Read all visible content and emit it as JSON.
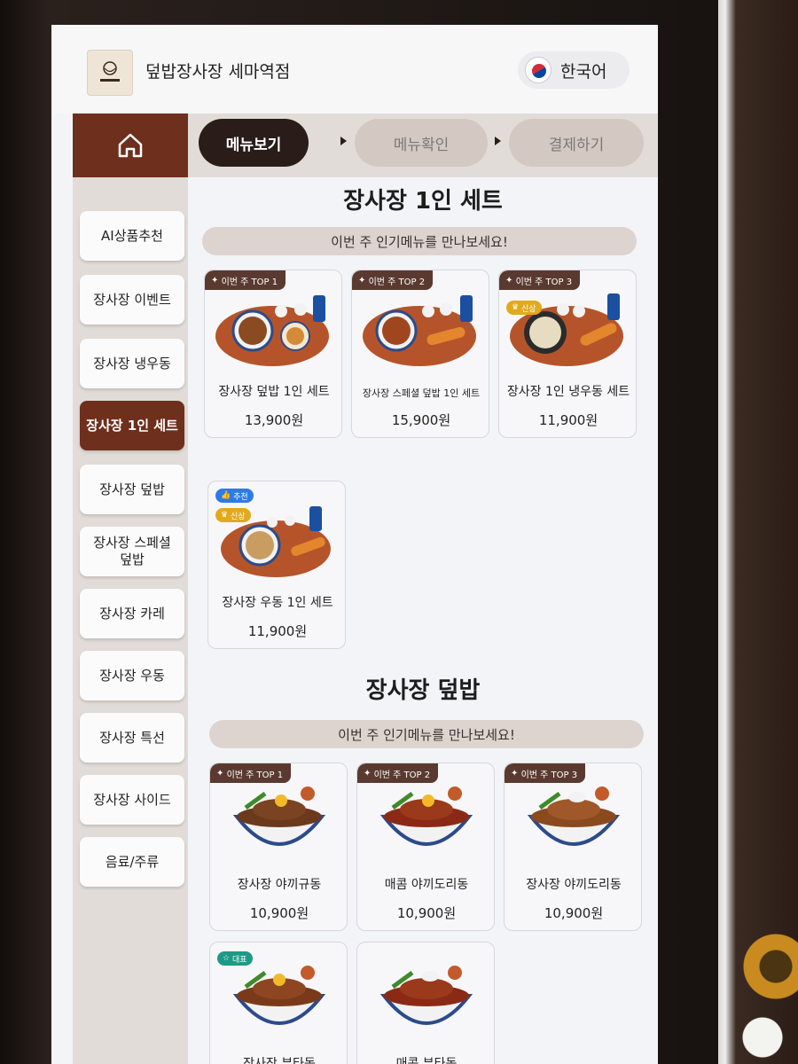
{
  "header": {
    "store_name": "덮밥장사장 세마역점",
    "language": "한국어",
    "logo_text": "덮밥장사장"
  },
  "steps": [
    "메뉴보기",
    "메뉴확인",
    "결제하기"
  ],
  "sidebar": {
    "items": [
      {
        "label": "AI상품추천",
        "active": false
      },
      {
        "label": "장사장 이벤트",
        "active": false
      },
      {
        "label": "장사장 냉우동",
        "active": false
      },
      {
        "label": "장사장 1인 세트",
        "active": true
      },
      {
        "label": "장사장 덮밥",
        "active": false
      },
      {
        "label": "장사장 스페셜 덮밥",
        "active": false
      },
      {
        "label": "장사장 카레",
        "active": false
      },
      {
        "label": "장사장 우동",
        "active": false
      },
      {
        "label": "장사장 특선",
        "active": false
      },
      {
        "label": "장사장 사이드",
        "active": false
      },
      {
        "label": "음료/주류",
        "active": false
      }
    ]
  },
  "sections": [
    {
      "title": "장사장 1인 세트",
      "banner": "이번 주 인기메뉴를 만나보세요!",
      "items": [
        {
          "name": "장사장 덮밥 1인 세트",
          "price": "13,900원",
          "badge": "이번 주 TOP 1",
          "chips": []
        },
        {
          "name": "장사장 스페셜 덮밥 1인 세트",
          "price": "15,900원",
          "badge": "이번 주 TOP 2",
          "chips": []
        },
        {
          "name": "장사장 1인 냉우동 세트",
          "price": "11,900원",
          "badge": "이번 주 TOP 3",
          "chips": [
            "신상"
          ]
        },
        {
          "name": "장사장 우동 1인 세트",
          "price": "11,900원",
          "badge": "",
          "chips": [
            "추천",
            "신상"
          ]
        }
      ]
    },
    {
      "title": "장사장 덮밥",
      "banner": "이번 주 인기메뉴를 만나보세요!",
      "items": [
        {
          "name": "장사장 야끼규동",
          "price": "10,900원",
          "badge": "이번 주 TOP 1",
          "chips": []
        },
        {
          "name": "매콤 야끼도리동",
          "price": "10,900원",
          "badge": "이번 주 TOP 2",
          "chips": []
        },
        {
          "name": "장사장 야끼도리동",
          "price": "10,900원",
          "badge": "이번 주 TOP 3",
          "chips": []
        },
        {
          "name": "장사장 부타동",
          "price": "",
          "badge": "",
          "chips": [
            "대표"
          ]
        },
        {
          "name": "매콤 부타동",
          "price": "",
          "badge": "",
          "chips": []
        }
      ]
    }
  ],
  "icons": {
    "home": "home-icon",
    "cart": "cart-icon",
    "flag": "korea-flag-icon",
    "badge_star": "sparkle-icon"
  },
  "colors": {
    "brand": "#6e2f1d",
    "active_step": "#2a1d19",
    "banner_bg": "#ddd4cf",
    "badge_bg": "#5a3a30"
  }
}
